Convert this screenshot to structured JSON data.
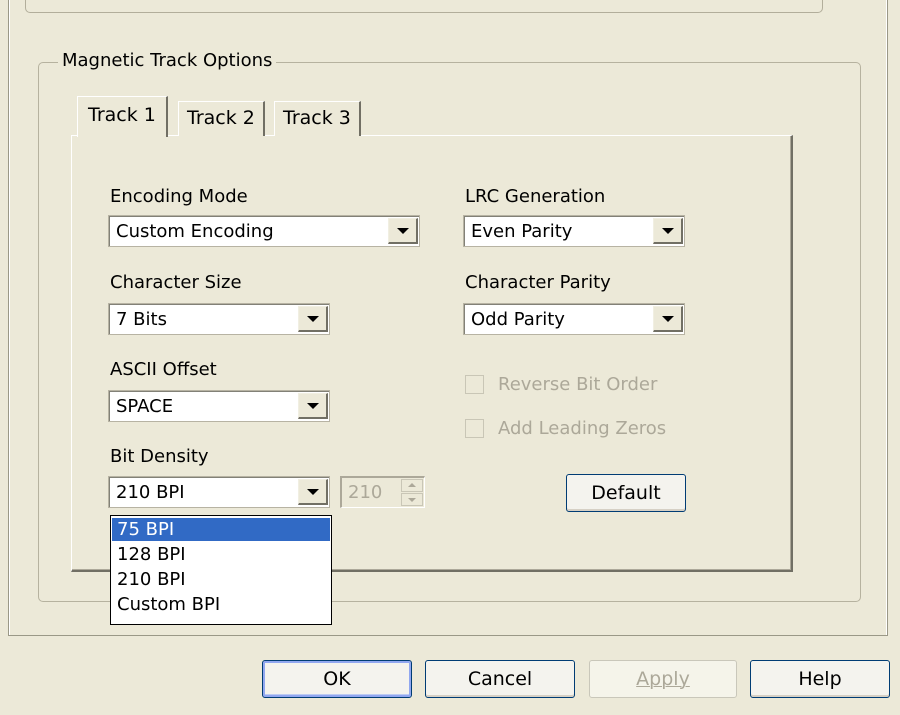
{
  "groupbox": {
    "title": "Magnetic Track Options"
  },
  "tabs": [
    {
      "label": "Track 1",
      "active": true
    },
    {
      "label": "Track 2",
      "active": false
    },
    {
      "label": "Track 3",
      "active": false
    }
  ],
  "encoding_mode": {
    "label": "Encoding Mode",
    "value": "Custom Encoding"
  },
  "character_size": {
    "label": "Character Size",
    "value": "7 Bits"
  },
  "ascii_offset": {
    "label": "ASCII Offset",
    "value": "SPACE"
  },
  "bit_density": {
    "label": "Bit Density",
    "value": "210 BPI",
    "spinner_value": "210",
    "options": [
      "75 BPI",
      "128 BPI",
      "210 BPI",
      "Custom BPI"
    ],
    "highlighted_option": "75 BPI"
  },
  "lrc_generation": {
    "label": "LRC Generation",
    "value": "Even Parity"
  },
  "character_parity": {
    "label": "Character Parity",
    "value": "Odd Parity"
  },
  "reverse_bit_order": {
    "label": "Reverse Bit Order",
    "checked": false,
    "enabled": false
  },
  "add_leading_zeros": {
    "label": "Add Leading Zeros",
    "checked": false,
    "enabled": false
  },
  "default_button": "Default",
  "dialog_buttons": {
    "ok": "OK",
    "cancel": "Cancel",
    "apply": "Apply",
    "help": "Help"
  },
  "colors": {
    "dialog_bg": "#ece9d8",
    "selection": "#316ac5",
    "disabled_text": "#aca899",
    "button_border": "#003c74"
  }
}
